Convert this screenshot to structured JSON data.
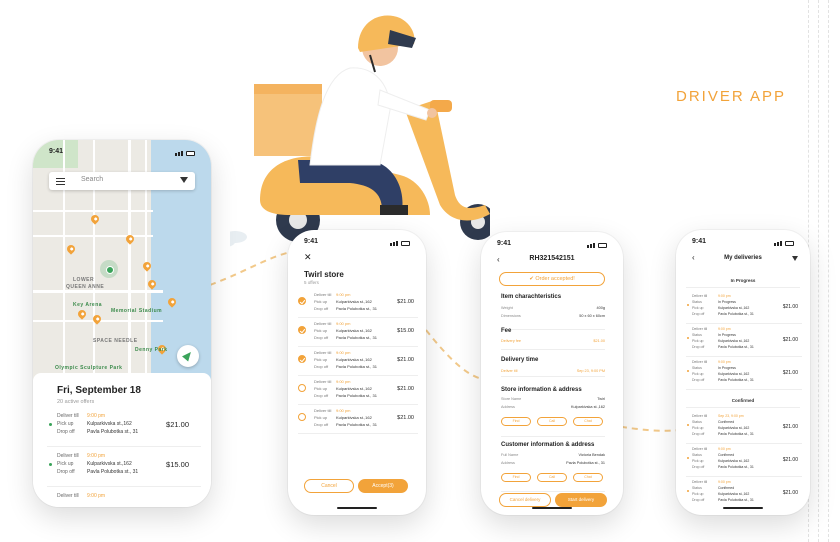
{
  "brand": {
    "title": "DRIVER APP"
  },
  "colors": {
    "accent": "#f2a33a",
    "green": "#3aa35a",
    "water": "#bcd9ec"
  },
  "map_screen": {
    "time": "9:41",
    "search_placeholder": "Search",
    "labels": [
      "LOWER",
      "QUEEN ANNE",
      "Memorial Stadium",
      "SPACE NEEDLE",
      "Denny Park",
      "Olympic Sculpture Park",
      "Key Arena"
    ],
    "date_title": "Fri, September 18",
    "subtitle": "20 active offers",
    "orders": [
      {
        "deliver_label": "Deliver till",
        "deliver_val": "9:00 pm",
        "pickup_label": "Pick up",
        "pickup_val": "Kulparkivska st.,162",
        "drop_label": "Drop off",
        "drop_val": "Pavla Polubotka st., 31",
        "price": "$21.00"
      },
      {
        "deliver_label": "Deliver till",
        "deliver_val": "9:00 pm",
        "pickup_label": "Pick up",
        "pickup_val": "Kulparkivska st.,162",
        "drop_label": "Drop off",
        "drop_val": "Pavla Polubotka st., 31",
        "price": "$15.00"
      },
      {
        "deliver_label": "Deliver till",
        "deliver_val": "9:00 pm",
        "pickup_label": "",
        "pickup_val": "",
        "drop_label": "",
        "drop_val": "",
        "price": ""
      }
    ]
  },
  "offers_screen": {
    "time": "9:41",
    "close_icon": "✕",
    "title": "Twirl store",
    "subtitle": "5 offers",
    "offers": [
      {
        "checked": true,
        "deliver_label": "Deliver till",
        "deliver_val": "9:00 pm",
        "pickup_label": "Pick up",
        "pickup_val": "Kulparkivska st.,162",
        "drop_label": "Drop off",
        "drop_val": "Pavla Polubotka st., 31",
        "price": "$21.00"
      },
      {
        "checked": true,
        "deliver_label": "Deliver till",
        "deliver_val": "9:00 pm",
        "pickup_label": "Pick up",
        "pickup_val": "Kulparkivska st.,162",
        "drop_label": "Drop off",
        "drop_val": "Pavla Polubotka st., 31",
        "price": "$15.00"
      },
      {
        "checked": true,
        "deliver_label": "Deliver till",
        "deliver_val": "9:00 pm",
        "pickup_label": "Pick up",
        "pickup_val": "Kulparkivska st.,162",
        "drop_label": "Drop off",
        "drop_val": "Pavla Polubotka st., 31",
        "price": "$21.00"
      },
      {
        "checked": false,
        "deliver_label": "Deliver till",
        "deliver_val": "9:00 pm",
        "pickup_label": "Pick up",
        "pickup_val": "Kulparkivska st.,162",
        "drop_label": "Drop off",
        "drop_val": "Pavla Polubotka st., 31",
        "price": "$21.00"
      },
      {
        "checked": false,
        "deliver_label": "Deliver till",
        "deliver_val": "9:00 pm",
        "pickup_label": "Pick up",
        "pickup_val": "Kulparkivska st.,162",
        "drop_label": "Drop off",
        "drop_val": "Pavla Polubotka st., 31",
        "price": "$21.00"
      }
    ],
    "cancel_label": "Cancel",
    "accept_label": "Accept(3)"
  },
  "order_screen": {
    "time": "9:41",
    "order_id": "RH321542151",
    "accepted_label": "✔ Order accepted!",
    "item_title": "Item charachteristics",
    "weight_label": "Weight",
    "weight_val": "400g",
    "dimensions_label": "Dimensions",
    "dimensions_val": "50 x 60 x 60cm",
    "fee_title": "Fee",
    "delivery_fee_label": "Delivery fee",
    "delivery_fee_val": "$21.00",
    "delivery_time_title": "Delivery time",
    "deliver_till_label": "Deliver till",
    "deliver_till_val": "Sep 23, 9:00 PM",
    "store_title": "Store information & address",
    "store_name_label": "Store Name",
    "store_name_val": "Twirl",
    "store_address_label": "Address",
    "store_address_val": "Kulparkivska st.,162",
    "customer_title": "Customer information & address",
    "full_name_label": "Full Name",
    "full_name_val": "Victoria Bendak",
    "customer_address_label": "Address",
    "customer_address_val": "Pavla Polubotka st., 31",
    "find_label": "Find",
    "call_label": "Call",
    "chat_label": "Chat",
    "cancel_label": "Cancel delivery",
    "start_label": "Start delivery"
  },
  "deliveries_screen": {
    "time": "9:41",
    "title": "My deliveries",
    "in_progress_label": "In Progress",
    "confirmed_label": "Confirmed",
    "in_progress": [
      {
        "deliver_label": "Deliver till",
        "deliver_val": "9:00 pm",
        "status_label": "Status",
        "status_val": "In Progress",
        "pickup_label": "Pick up",
        "pickup_val": "Kulparkivska st.,162",
        "drop_label": "Drop off",
        "drop_val": "Pavla Polubotka st., 31",
        "price": "$21.00"
      },
      {
        "deliver_label": "Deliver till",
        "deliver_val": "9:00 pm",
        "status_label": "Status",
        "status_val": "In Progress",
        "pickup_label": "Pick up",
        "pickup_val": "Kulparkivska st.,162",
        "drop_label": "Drop off",
        "drop_val": "Pavla Polubotka st., 31",
        "price": "$21.00"
      },
      {
        "deliver_label": "Deliver till",
        "deliver_val": "9:00 pm",
        "status_label": "Status",
        "status_val": "In Progress",
        "pickup_label": "Pick up",
        "pickup_val": "Kulparkivska st.,162",
        "drop_label": "Drop off",
        "drop_val": "Pavla Polubotka st., 31",
        "price": "$21.00"
      }
    ],
    "confirmed": [
      {
        "deliver_label": "Deliver till",
        "deliver_val": "Sep 23, 9:00 pm",
        "status_label": "Status",
        "status_val": "Confirmed",
        "pickup_label": "Pick up",
        "pickup_val": "Kulparkivska st.,162",
        "drop_label": "Drop off",
        "drop_val": "Pavla Polubotka st., 31",
        "price": "$21.00"
      },
      {
        "deliver_label": "Deliver till",
        "deliver_val": "9:00 pm",
        "status_label": "Status",
        "status_val": "Confirmed",
        "pickup_label": "Pick up",
        "pickup_val": "Kulparkivska st.,162",
        "drop_label": "Drop off",
        "drop_val": "Pavla Polubotka st., 31",
        "price": "$21.00"
      },
      {
        "deliver_label": "Deliver till",
        "deliver_val": "9:00 pm",
        "status_label": "Status",
        "status_val": "Confirmed",
        "pickup_label": "Pick up",
        "pickup_val": "Kulparkivska st.,162",
        "drop_label": "Drop off",
        "drop_val": "Pavla Polubotka st., 31",
        "price": "$21.00"
      }
    ]
  }
}
